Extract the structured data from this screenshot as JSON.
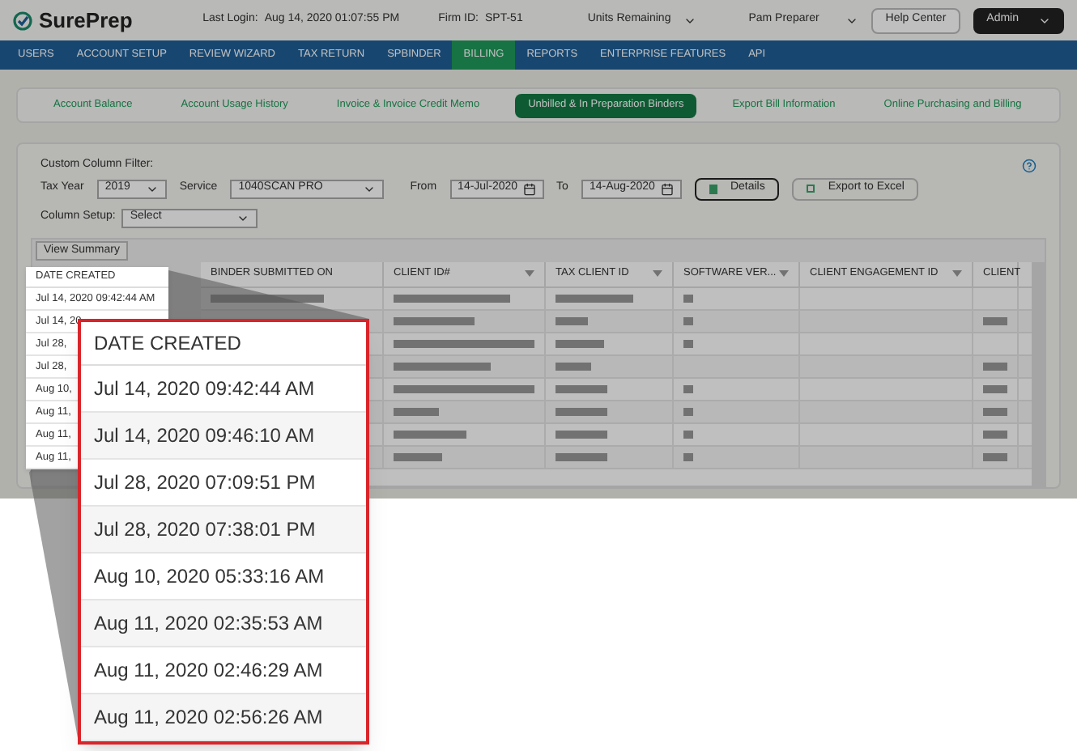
{
  "header": {
    "logo": "SurePrep",
    "last_login_label": "Last Login:",
    "last_login": "Aug 14, 2020 01:07:55 PM",
    "firm_label": "Firm ID:",
    "firm_id": "SPT-51",
    "units": "Units Remaining",
    "user": "Pam Preparer",
    "help": "Help Center",
    "role": "Admin"
  },
  "nav": [
    {
      "label": "USERS",
      "selected": false
    },
    {
      "label": "ACCOUNT SETUP",
      "selected": false
    },
    {
      "label": "REVIEW WIZARD",
      "selected": false
    },
    {
      "label": "TAX RETURN",
      "selected": false
    },
    {
      "label": "SPBINDER",
      "selected": false
    },
    {
      "label": "BILLING",
      "selected": true
    },
    {
      "label": "REPORTS",
      "selected": false
    },
    {
      "label": "ENTERPRISE FEATURES",
      "selected": false
    },
    {
      "label": "API",
      "selected": false
    }
  ],
  "subtabs": [
    {
      "label": "Account Balance",
      "selected": false
    },
    {
      "label": "Account Usage History",
      "selected": false
    },
    {
      "label": "Invoice & Invoice Credit Memo",
      "selected": false
    },
    {
      "label": "Unbilled & In Preparation Binders",
      "selected": true
    },
    {
      "label": "Export Bill Information",
      "selected": false
    },
    {
      "label": "Online Purchasing and Billing",
      "selected": false
    }
  ],
  "filters": {
    "title": "Custom Column Filter:",
    "tax_year_label": "Tax Year",
    "tax_year": "2019",
    "service_label": "Service",
    "service": "1040SCAN PRO",
    "from_label": "From",
    "from": "14-Jul-2020",
    "to_label": "To",
    "to": "14-Aug-2020",
    "details": "Details",
    "export": "Export to Excel",
    "column_setup_label": "Column Setup:",
    "column_setup": "Select"
  },
  "view_summary": "View Summary",
  "table": {
    "columns": [
      {
        "label": "BINDER SUBMITTED ON",
        "filter": false
      },
      {
        "label": "CLIENT ID#",
        "filter": true
      },
      {
        "label": "TAX CLIENT ID",
        "filter": true
      },
      {
        "label": "SOFTWARE VER...",
        "filter": true
      },
      {
        "label": "CLIENT ENGAGEMENT ID",
        "filter": true
      },
      {
        "label": "CLIENT",
        "filter": false
      }
    ]
  },
  "date_column": {
    "header": "DATE CREATED",
    "cells": [
      "Jul 14, 2020 09:42:44 AM",
      "Jul 14, 20",
      "Jul 28,",
      "Jul 28,",
      "Aug 10,",
      "Aug 11,",
      "Aug 11,",
      "Aug 11,"
    ]
  },
  "magnifier": {
    "header": "DATE CREATED",
    "cells": [
      "Jul 14, 2020 09:42:44 AM",
      "Jul 14, 2020 09:46:10 AM",
      "Jul 28, 2020 07:09:51 PM",
      "Jul 28, 2020 07:38:01 PM",
      "Aug 10, 2020 05:33:16 AM",
      "Aug 11, 2020 02:35:53 AM",
      "Aug 11, 2020 02:46:29 AM",
      "Aug 11, 2020 02:56:26 AM"
    ]
  }
}
